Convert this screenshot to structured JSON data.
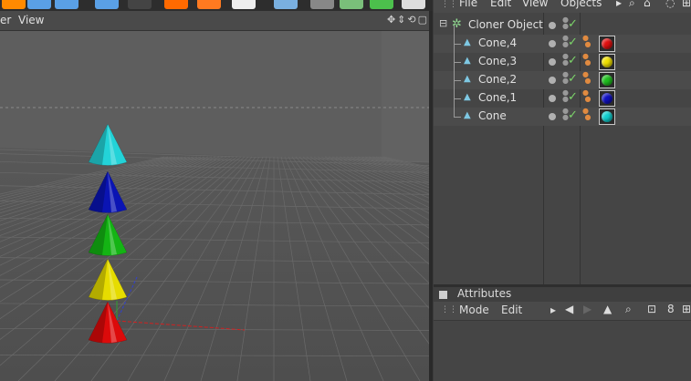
{
  "viewport": {
    "menu_partial": "er",
    "menu_view": "View",
    "nav_icons": "✥⇕⟲▢"
  },
  "object_manager": {
    "menu": {
      "file": "File",
      "edit": "Edit",
      "view": "View",
      "objects": "Objects"
    },
    "objects": [
      {
        "name": "Cloner Object",
        "color": ""
      },
      {
        "name": "Cone,4",
        "color": "#e01010"
      },
      {
        "name": "Cone,3",
        "color": "#f0e000"
      },
      {
        "name": "Cone,2",
        "color": "#20c020"
      },
      {
        "name": "Cone,1",
        "color": "#1010c0"
      },
      {
        "name": "Cone",
        "color": "#10d0d0"
      }
    ]
  },
  "attributes": {
    "title": "Attributes",
    "menu": {
      "mode": "Mode",
      "edit": "Edit"
    }
  },
  "cones_colors": [
    "#23d3d8",
    "#0a14b4",
    "#14b414",
    "#e6dc00",
    "#dc0a0a"
  ]
}
